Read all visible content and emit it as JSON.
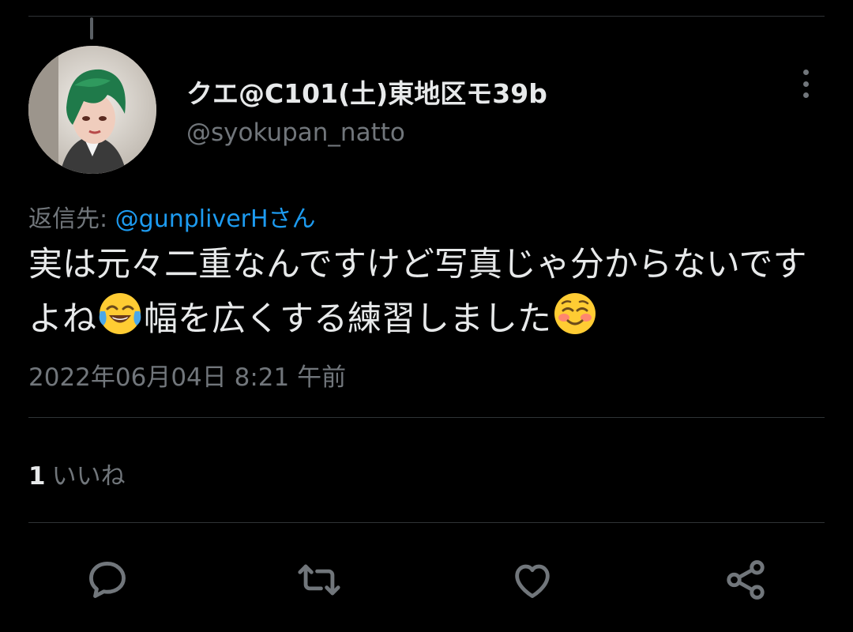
{
  "tweet": {
    "author": {
      "display_name": "クエ@C101(土)東地区モ39b",
      "handle": "@syokupan_natto"
    },
    "reply_to": {
      "prefix": "返信先: ",
      "mention": "@gunpliverHさん"
    },
    "text_part1": "実は元々二重なんですけど写真じゃ分からないですよね",
    "emoji1": "face-with-tears-of-joy-emoji",
    "text_part2": "幅を広くする練習しました",
    "emoji2": "smiling-face-emoji",
    "timestamp": "2022年06月04日 8:21 午前",
    "likes": {
      "count": "1",
      "label": "いいね"
    }
  },
  "actions": [
    {
      "icon": "reply-icon"
    },
    {
      "icon": "retweet-icon"
    },
    {
      "icon": "like-icon"
    },
    {
      "icon": "share-icon"
    }
  ],
  "colors": {
    "background": "#000000",
    "primary_text": "#e7e9ea",
    "secondary_text": "#71767b",
    "link": "#1d9bf0",
    "divider": "#2f3336"
  }
}
